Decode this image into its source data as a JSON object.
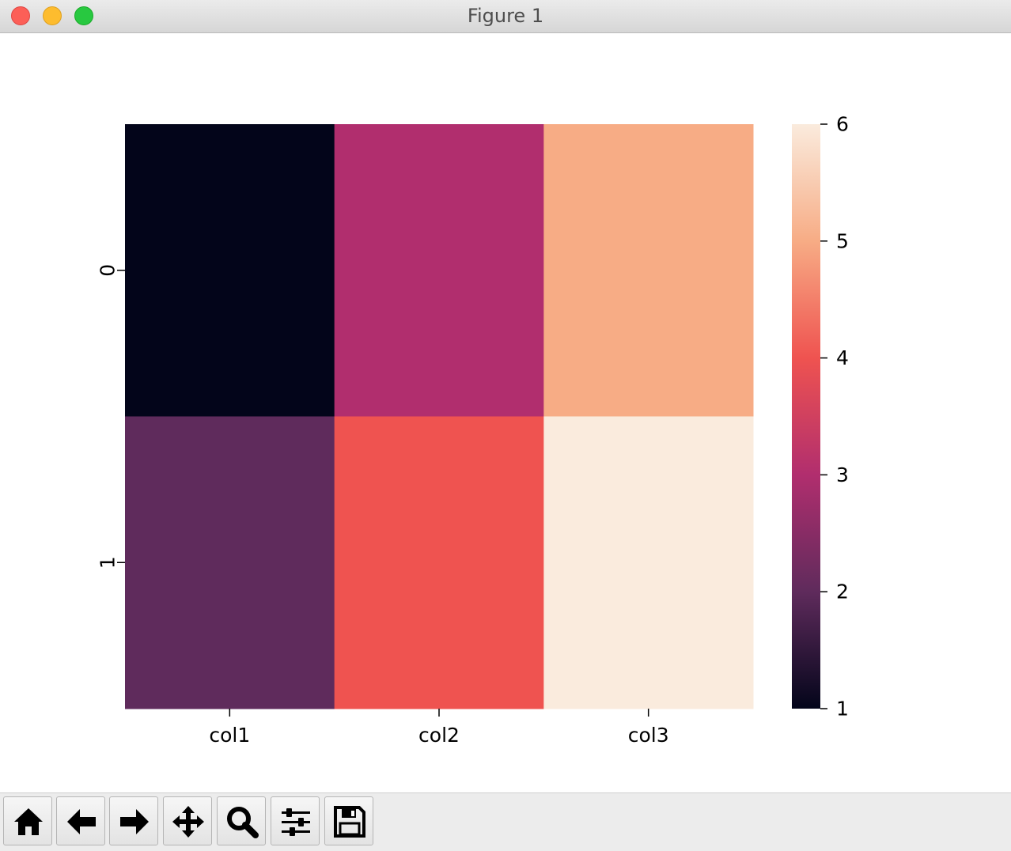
{
  "window": {
    "title": "Figure 1"
  },
  "toolbar": {
    "buttons": [
      {
        "name": "home-button",
        "icon": "home-icon"
      },
      {
        "name": "back-button",
        "icon": "arrow-left-icon"
      },
      {
        "name": "forward-button",
        "icon": "arrow-right-icon"
      },
      {
        "name": "pan-button",
        "icon": "move-icon"
      },
      {
        "name": "zoom-button",
        "icon": "magnifier-icon"
      },
      {
        "name": "configure-subplots-button",
        "icon": "sliders-icon"
      },
      {
        "name": "save-button",
        "icon": "floppy-disk-icon"
      }
    ]
  },
  "chart_data": {
    "type": "heatmap",
    "title": "",
    "xlabel": "",
    "ylabel": "",
    "x_categories": [
      "col1",
      "col2",
      "col3"
    ],
    "y_categories": [
      "0",
      "1"
    ],
    "values": [
      [
        1,
        3,
        5
      ],
      [
        2,
        4,
        6
      ]
    ],
    "colormap": "rocket",
    "colorbar": {
      "range": [
        1,
        6
      ],
      "ticks": [
        "1",
        "2",
        "3",
        "4",
        "5",
        "6"
      ]
    },
    "grid": false,
    "legend": "none"
  }
}
